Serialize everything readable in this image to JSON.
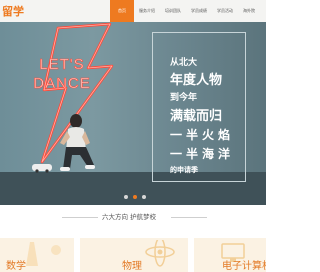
{
  "brand": {
    "logo_text": "留学"
  },
  "nav": {
    "items": [
      {
        "label": "首页",
        "active": true
      },
      {
        "label": "服务介绍",
        "active": false
      },
      {
        "label": "培训团队",
        "active": false
      },
      {
        "label": "学员成绩",
        "active": false
      },
      {
        "label": "学员活动",
        "active": false
      },
      {
        "label": "海外院",
        "active": false
      }
    ]
  },
  "hero": {
    "neon_text": [
      "LET'S",
      "DANCE"
    ],
    "slogan": [
      "从北大",
      "年度人物",
      "到今年",
      "满载而归",
      "一半火焰",
      "一半海洋",
      "的申请季"
    ],
    "slide_count": 3,
    "active_slide": 2
  },
  "section": {
    "title": "六大方向 护航梦校"
  },
  "subjects": [
    {
      "label": "数学"
    },
    {
      "label": "物理"
    },
    {
      "label": "电子计算机"
    }
  ],
  "colors": {
    "accent": "#ee7a20",
    "neon": "#ff4a3a",
    "card_bg": "#fbf2e3",
    "hero_wall": "#7c99a1"
  }
}
